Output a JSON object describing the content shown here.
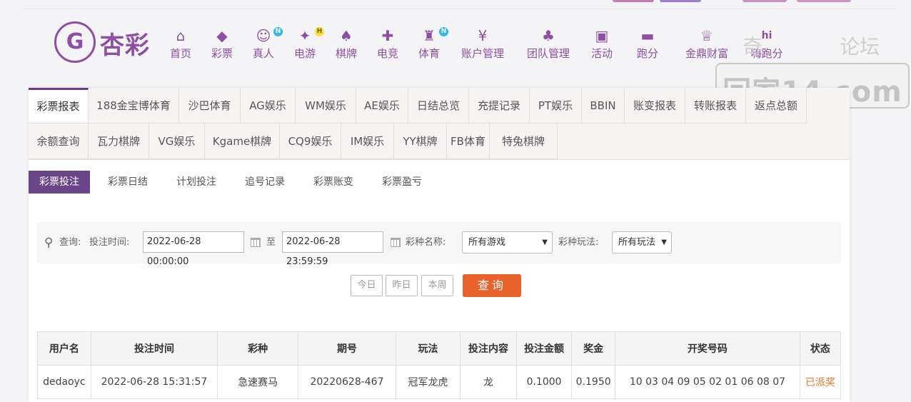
{
  "brand": {
    "logo_mark": "G",
    "logo_text": "杏彩"
  },
  "nav": [
    {
      "label": "首页",
      "icon": "home-icon",
      "glyph": "⌂",
      "badge": ""
    },
    {
      "label": "彩票",
      "icon": "lottery-ticket-icon",
      "glyph": "◆",
      "badge": ""
    },
    {
      "label": "真人",
      "icon": "live-dealer-icon",
      "glyph": "☺",
      "badge": "N"
    },
    {
      "label": "电游",
      "icon": "slot-controller-icon",
      "glyph": "✦",
      "badge": "H"
    },
    {
      "label": "棋牌",
      "icon": "cards-icon",
      "glyph": "♠",
      "badge": ""
    },
    {
      "label": "电竞",
      "icon": "gamepad-icon",
      "glyph": "✚",
      "badge": ""
    },
    {
      "label": "体育",
      "icon": "trophy-icon",
      "glyph": "♜",
      "badge": "N"
    },
    {
      "label": "账户管理",
      "icon": "yen-coin-icon",
      "glyph": "¥",
      "badge": ""
    },
    {
      "label": "团队管理",
      "icon": "team-icon",
      "glyph": "♣",
      "badge": ""
    },
    {
      "label": "活动",
      "icon": "gift-icon",
      "glyph": "▣",
      "badge": ""
    },
    {
      "label": "跑分",
      "icon": "race-car-icon",
      "glyph": "▬",
      "badge": ""
    },
    {
      "label": "金鼎财富",
      "icon": "treasure-icon",
      "glyph": "♕",
      "badge": ""
    },
    {
      "label": "嗨跑分",
      "icon": "hi-icon",
      "glyph": "hi",
      "badge": ""
    }
  ],
  "watermark": {
    "text": "回家14.com",
    "top_left": "奇",
    "top_right": "论坛"
  },
  "report_tabs_row1": [
    "彩票报表",
    "188金宝博体育",
    "沙巴体育",
    "AG娱乐",
    "WM娱乐",
    "AE娱乐",
    "日结总览",
    "充提记录",
    "PT娱乐",
    "BBIN",
    "账变报表",
    "转账报表",
    "返点总额"
  ],
  "report_tabs_row2": [
    "余额查询",
    "瓦力棋牌",
    "VG娱乐",
    "Kgame棋牌",
    "CQ9娱乐",
    "IM娱乐",
    "YY棋牌",
    "FB体育",
    "特兔棋牌"
  ],
  "sub_tabs": [
    "彩票投注",
    "彩票日结",
    "计划投注",
    "追号记录",
    "彩票账变",
    "彩票盈亏"
  ],
  "filter": {
    "query_label": "查询:",
    "time_label": "投注时间:",
    "start_time": "2022-06-28 00:00:00",
    "to_label": "至",
    "end_time": "2022-06-28 23:59:59",
    "game_label": "彩种名称:",
    "game_value": "所有游戏",
    "play_label": "彩种玩法:",
    "play_value": "所有玩法"
  },
  "quick_buttons": [
    "今日",
    "昨日",
    "本周"
  ],
  "search_button": "查询",
  "table": {
    "headers": [
      "用户名",
      "投注时间",
      "彩种",
      "期号",
      "玩法",
      "投注内容",
      "投注金额",
      "奖金",
      "开奖号码",
      "状态"
    ],
    "rows": [
      [
        "dedaoyc",
        "2022-06-28 15:31:57",
        "急速赛马",
        "20220628-467",
        "冠军龙虎",
        "龙",
        "0.1000",
        "0.1950",
        "10 03 04 09 05 02 01 06 08 07",
        "已派奖"
      ]
    ]
  },
  "colors": {
    "brand_purple": "#8e4fa3",
    "active_tab": "#6a4587",
    "search_orange": "#e9622c",
    "status_orange": "#e9762a"
  }
}
